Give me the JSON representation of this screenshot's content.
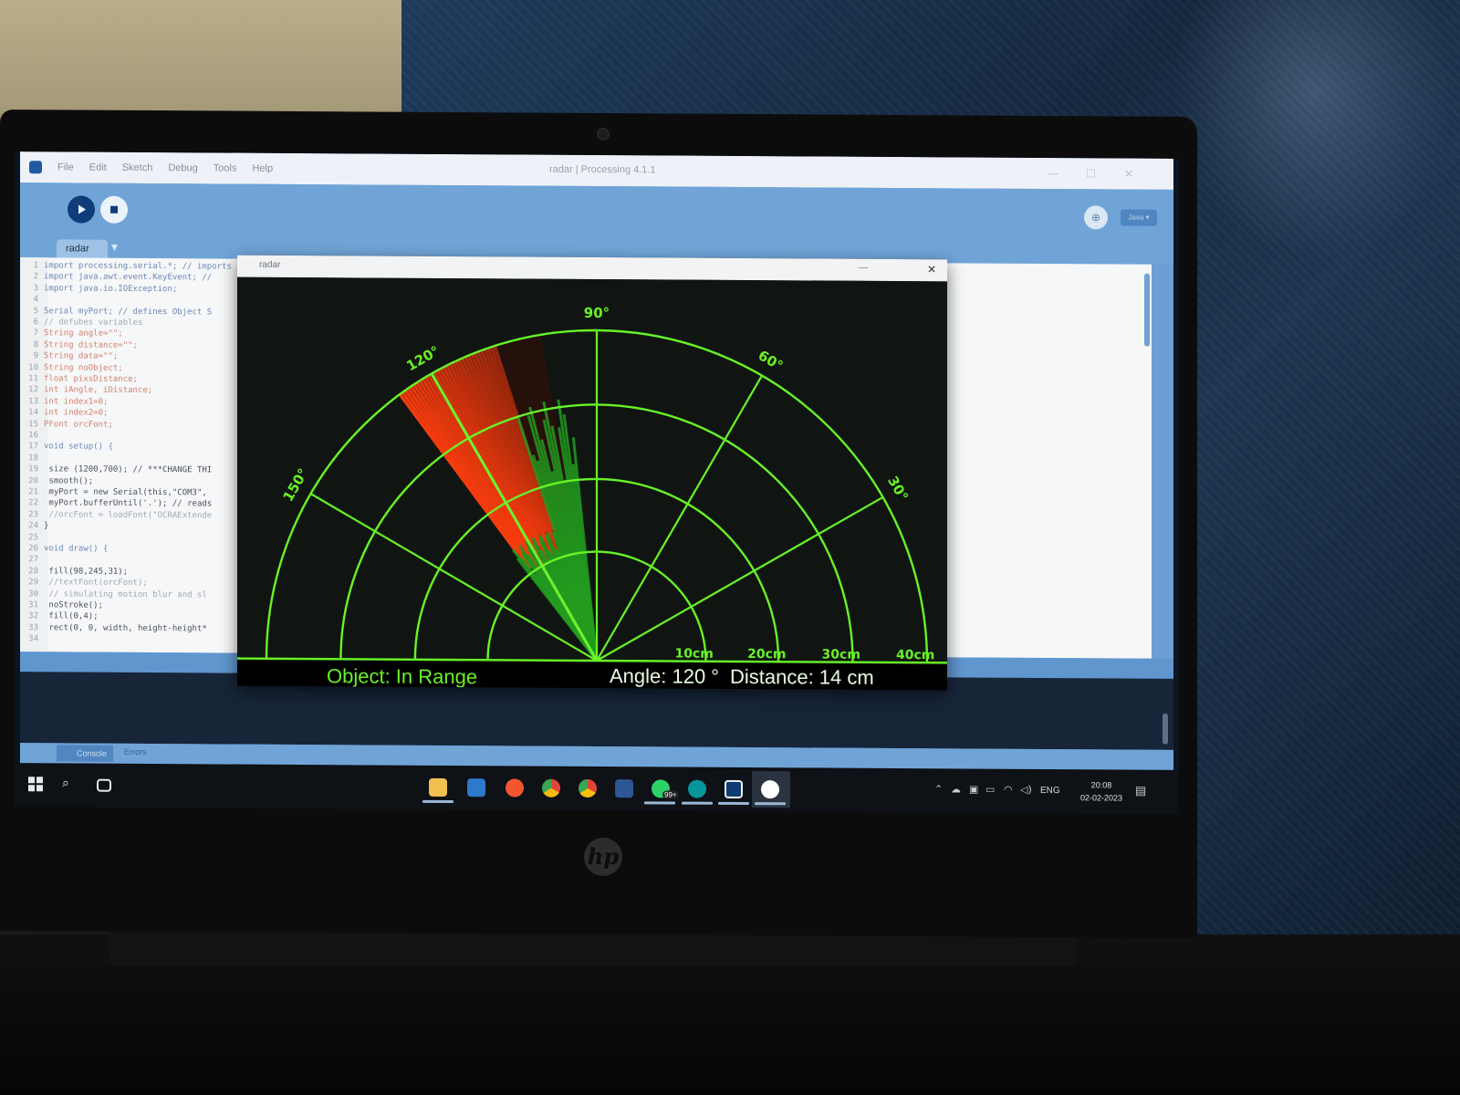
{
  "ide": {
    "window_title": "radar | Processing 4.1.1",
    "menu": [
      "File",
      "Edit",
      "Sketch",
      "Debug",
      "Tools",
      "Help"
    ],
    "mode_label": "Java ▾",
    "tab_name": "radar",
    "console_tab": "Console",
    "errors_tab": "Errors",
    "code_lines": [
      {
        "n": "1",
        "text": "import processing.serial.*; // imports library for serial communication"
      },
      {
        "n": "2",
        "text": "import java.awt.event.KeyEvent; //"
      },
      {
        "n": "3",
        "text": "import java.io.IOException;"
      },
      {
        "n": "4",
        "text": ""
      },
      {
        "n": "5",
        "text": "Serial myPort; // defines Object S"
      },
      {
        "n": "6",
        "text": "// defubes variables"
      },
      {
        "n": "7",
        "text": "String angle=\"\";"
      },
      {
        "n": "8",
        "text": "String distance=\"\";"
      },
      {
        "n": "9",
        "text": "String data=\"\";"
      },
      {
        "n": "10",
        "text": "String noObject;"
      },
      {
        "n": "11",
        "text": "float pixsDistance;"
      },
      {
        "n": "12",
        "text": "int iAngle, iDistance;"
      },
      {
        "n": "13",
        "text": "int index1=0;"
      },
      {
        "n": "14",
        "text": "int index2=0;"
      },
      {
        "n": "15",
        "text": "PFont orcFont;"
      },
      {
        "n": "16",
        "text": ""
      },
      {
        "n": "17",
        "text": "void setup() {"
      },
      {
        "n": "18",
        "text": ""
      },
      {
        "n": "19",
        "text": " size (1200,700); // ***CHANGE THI"
      },
      {
        "n": "20",
        "text": " smooth();"
      },
      {
        "n": "21",
        "text": " myPort = new Serial(this,\"COM3\","
      },
      {
        "n": "22",
        "text": " myPort.bufferUntil('.'); // reads"
      },
      {
        "n": "23",
        "text": " //orcFont = loadFont(\"OCRAExtende"
      },
      {
        "n": "24",
        "text": "}"
      },
      {
        "n": "25",
        "text": ""
      },
      {
        "n": "26",
        "text": "void draw() {"
      },
      {
        "n": "27",
        "text": ""
      },
      {
        "n": "28",
        "text": " fill(98,245,31);"
      },
      {
        "n": "29",
        "text": " //textFont(orcFont);"
      },
      {
        "n": "30",
        "text": " // simulating motion blur and sl"
      },
      {
        "n": "31",
        "text": " noStroke();"
      },
      {
        "n": "32",
        "text": " fill(0,4);"
      },
      {
        "n": "33",
        "text": " rect(0, 0, width, height-height*"
      },
      {
        "n": "34",
        "text": ""
      }
    ]
  },
  "radar": {
    "window_title": "radar",
    "angle_labels": [
      "30°",
      "60°",
      "90°",
      "120°",
      "150°"
    ],
    "range_labels": [
      "10cm",
      "20cm",
      "30cm",
      "40cm"
    ],
    "object_status": "Object: In Range",
    "angle_readout": "Angle: 120 °",
    "distance_readout": "Distance:  14 cm",
    "sweep_angle_deg": 120,
    "object_distance_cm": 14,
    "max_range_cm": 40,
    "colors": {
      "grid": "#62f51f",
      "object": "#ff3a0a",
      "sweep": "#1e9e1a",
      "background": "#101512"
    }
  },
  "taskbar": {
    "language": "ENG",
    "time": "20:08",
    "date": "02-02-2023",
    "apps": [
      "windows-start-icon",
      "search-icon",
      "task-view-icon",
      "file-explorer-icon",
      "vscode-icon",
      "brave-icon",
      "chrome-icon",
      "chrome-profile-icon",
      "word-icon",
      "whatsapp-icon",
      "arduino-icon",
      "processing-editor-icon",
      "processing-sketch-icon"
    ],
    "whatsapp_badge": "99+"
  },
  "laptop": {
    "brand": "hp"
  }
}
